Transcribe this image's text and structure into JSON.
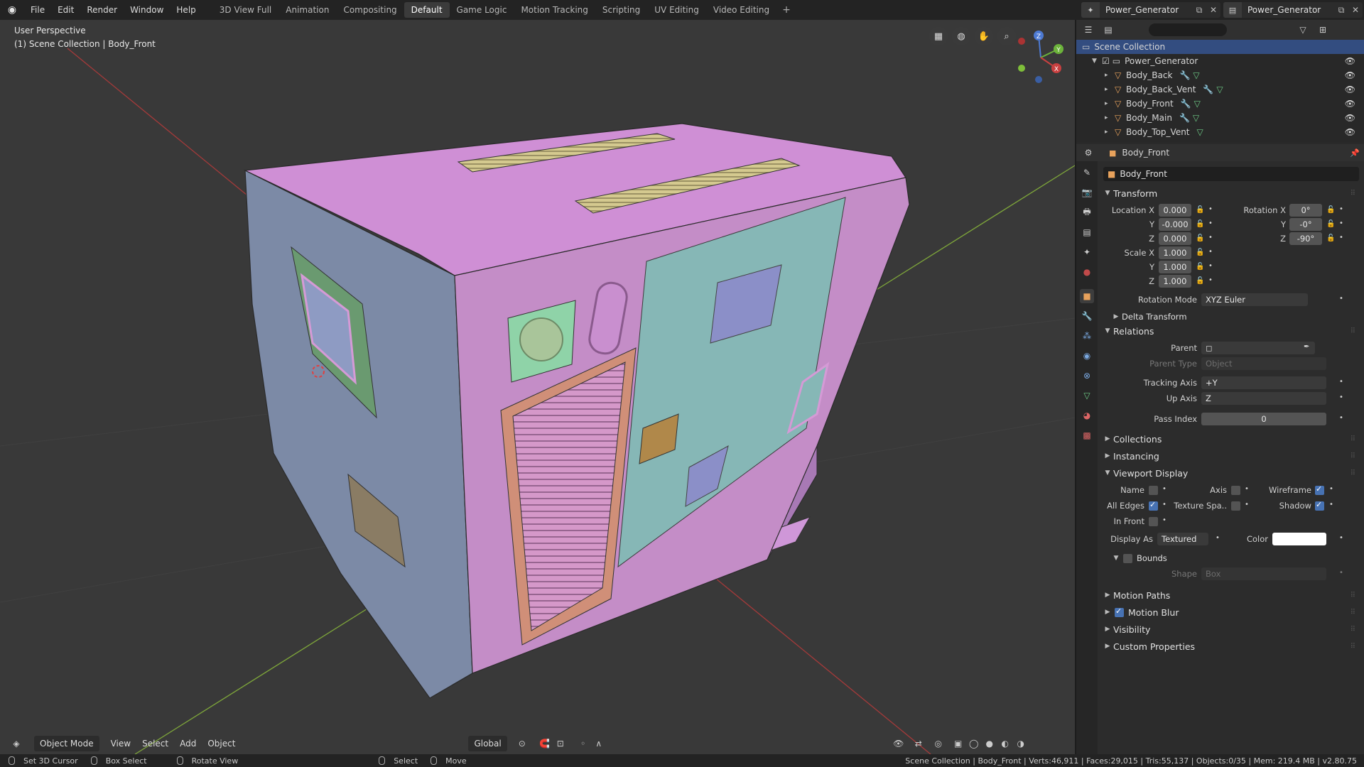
{
  "topbar": {
    "menus": [
      "File",
      "Edit",
      "Render",
      "Window",
      "Help"
    ],
    "workspaces": [
      "3D View Full",
      "Animation",
      "Compositing",
      "Default",
      "Game Logic",
      "Motion Tracking",
      "Scripting",
      "UV Editing",
      "Video Editing"
    ],
    "active_workspace": "Default",
    "add": "+",
    "scene_name": "Power_Generator",
    "viewlayer_name": "Power_Generator"
  },
  "viewport": {
    "perspective": "User Perspective",
    "collection_path": "(1) Scene Collection | Body_Front",
    "gizmo": {
      "z": "Z",
      "y": "Y",
      "x": "X"
    },
    "header": {
      "mode": "Object Mode",
      "menus": [
        "View",
        "Select",
        "Add",
        "Object"
      ],
      "orientation": "Global"
    }
  },
  "outliner": {
    "search_placeholder": "",
    "root": "Scene Collection",
    "collection": "Power_Generator",
    "items": [
      "Body_Back",
      "Body_Back_Vent",
      "Body_Front",
      "Body_Main",
      "Body_Top_Vent"
    ]
  },
  "properties": {
    "header_object": "Body_Front",
    "object_name": "Body_Front",
    "sections": {
      "transform": "Transform",
      "delta": "Delta Transform",
      "relations": "Relations",
      "collections": "Collections",
      "instancing": "Instancing",
      "viewport_display": "Viewport Display",
      "bounds": "Bounds",
      "motion_paths": "Motion Paths",
      "motion_blur": "Motion Blur",
      "visibility": "Visibility",
      "custom_props": "Custom Properties"
    },
    "labels": {
      "location_x": "Location X",
      "y": "Y",
      "z": "Z",
      "rotation_x": "Rotation X",
      "scale_x": "Scale X",
      "rotation_mode": "Rotation Mode",
      "parent": "Parent",
      "parent_type": "Parent Type",
      "tracking_axis": "Tracking Axis",
      "up_axis": "Up Axis",
      "pass_index": "Pass Index",
      "name": "Name",
      "axis": "Axis",
      "wireframe": "Wireframe",
      "all_edges": "All Edges",
      "texture_space": "Texture Spa..",
      "shadow": "Shadow",
      "in_front": "In Front",
      "display_as": "Display As",
      "color": "Color",
      "shape": "Shape"
    },
    "values": {
      "loc_x": "0.000",
      "loc_y": "-0.000",
      "loc_z": "0.000",
      "rot_x": "0°",
      "rot_y": "-0°",
      "rot_z": "-90°",
      "scale_x": "1.000",
      "scale_y": "1.000",
      "scale_z": "1.000",
      "rotation_mode": "XYZ Euler",
      "parent_type": "Object",
      "tracking_axis": "+Y",
      "up_axis": "Z",
      "pass_index": "0",
      "display_as": "Textured",
      "shape": "Box"
    },
    "checks": {
      "name": false,
      "axis": false,
      "wireframe": true,
      "all_edges": true,
      "texture_space": false,
      "shadow": true,
      "in_front": false,
      "bounds": false,
      "motion_blur": true
    },
    "display_color": "#ffffff"
  },
  "statusbar": {
    "left": [
      "Set 3D Cursor",
      "Box Select",
      "Rotate View",
      "Select",
      "Move"
    ],
    "stats": "Scene Collection | Body_Front | Verts:46,911 | Faces:29,015 | Tris:55,137 | Objects:0/35 | Mem: 219.4 MB | v2.80.75"
  },
  "colors": {
    "accent": "#4772b3",
    "selection": "#334d80",
    "mesh_pink": "#c98fcf",
    "mesh_teal": "#7fb3b0",
    "grid_x": "#b03a3a",
    "grid_y": "#7ea63a"
  }
}
